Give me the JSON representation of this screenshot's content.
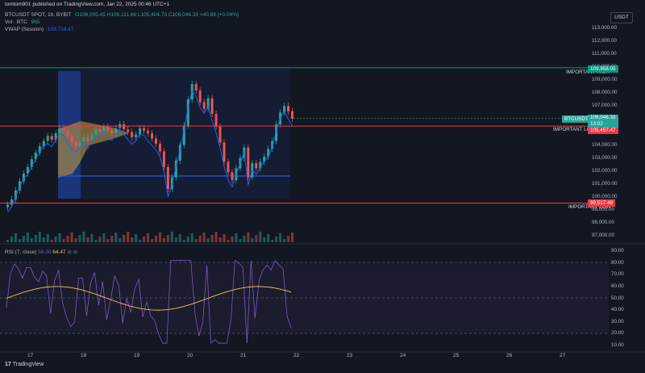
{
  "header": {
    "title": "tomtom901 published on TradingView.com, Jan 22, 2025 00:46 UTC+1",
    "symbol": "BTCUSDT SPOT, 1h, BYBIT",
    "ohlc": {
      "o": "O106,005.45",
      "h": "H106,111.66",
      "l": "L105,404.73",
      "c": "C106,046.33",
      "chg": "+40.88 (+0.04%)"
    },
    "vol_label": "Vol · BTC",
    "vol_value": "965",
    "vwap_label": "VWAP (Session)",
    "vwap_value": "103,718.47"
  },
  "currency": "USDT",
  "price_axis": [
    "113,000.00",
    "112,000.00",
    "111,000.00",
    "110,000.00",
    "109,000.00",
    "108,000.00",
    "107,000.00",
    "106,000.00",
    "105,000.00",
    "104,000.00",
    "103,000.00",
    "102,000.00",
    "101,000.00",
    "100,000.00",
    "99,000.00",
    "98,000.00",
    "97,000.00"
  ],
  "levels": {
    "important_high": {
      "label": "IMPORTANT HIGH",
      "price": "109,958.05",
      "value": 109958.05
    },
    "important_low_vah": {
      "label": "IMPORTANT LOW + VAH",
      "price": "105,457.47",
      "value": 105457.47
    },
    "important_low": {
      "label": "IMPORTANT LOW",
      "price": "99,517.48",
      "value": 99517.48
    },
    "current": {
      "label": "BTCUSDT",
      "price": "106,046.33",
      "countdown": "13:02",
      "value": 106046.33
    }
  },
  "rsi": {
    "label": "RSI (7, close)",
    "v1": "58.30",
    "v2": "64.47",
    "axis": [
      "90.00",
      "80.00",
      "70.00",
      "60.00",
      "50.00",
      "40.00",
      "30.00",
      "20.00",
      "10.00"
    ]
  },
  "x_axis": [
    "17",
    "18",
    "19",
    "20",
    "21",
    "22",
    "23",
    "24",
    "25",
    "26",
    "27"
  ],
  "footer": "TradingView",
  "colors": {
    "up": "#26a69a",
    "down": "#ef5350",
    "bg": "#131722",
    "level": "#f23645",
    "high_level": "#089981",
    "vwap": "#2962ff",
    "rsi": "#7e57c2",
    "rsi_ma": "#f7c948"
  }
}
